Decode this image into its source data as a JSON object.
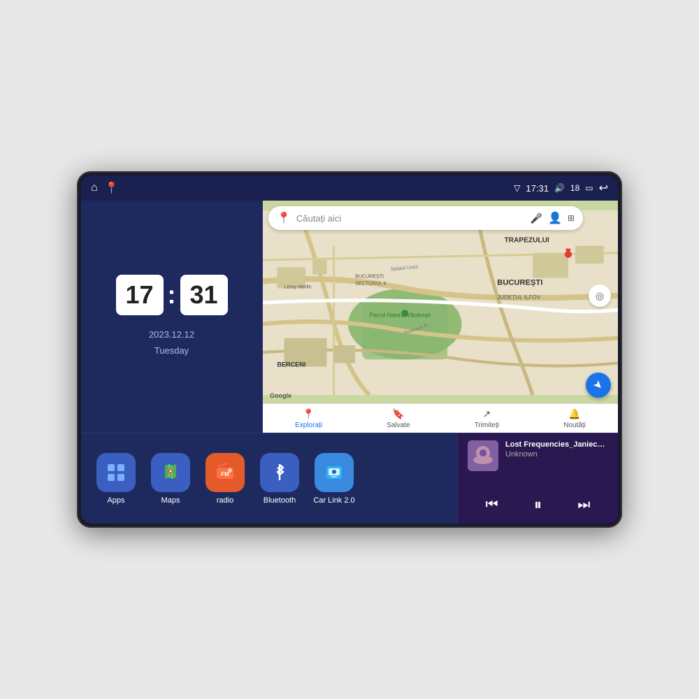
{
  "device": {
    "frame_bg": "#1a1a2e"
  },
  "status_bar": {
    "time": "17:31",
    "signal_icon": "▽",
    "volume_icon": "🔊",
    "battery_level": "18",
    "battery_icon": "🔋",
    "back_icon": "↩"
  },
  "clock": {
    "hours": "17",
    "minutes": "31",
    "date": "2023.12.12",
    "day": "Tuesday"
  },
  "map": {
    "search_placeholder": "Căutați aici",
    "trapezului_label": "TRAPEZULUI",
    "bucuresti_label": "BUCUREȘTI",
    "ilfov_label": "JUDEȚUL ILFOV",
    "berceni_label": "BERCENI",
    "parc_label": "Parcul Natural Văcărești",
    "leroy_label": "Leroy Merlin",
    "sector_label": "BUCUREȘTI SECTORUL 4",
    "google_label": "Google",
    "nav_items": [
      {
        "label": "Explorați",
        "active": true
      },
      {
        "label": "Salvate",
        "active": false
      },
      {
        "label": "Trimiteți",
        "active": false
      },
      {
        "label": "Noutăți",
        "active": false
      }
    ]
  },
  "apps": [
    {
      "label": "Apps",
      "icon_class": "icon-apps",
      "icon_char": "⊞"
    },
    {
      "label": "Maps",
      "icon_class": "icon-maps",
      "icon_char": "📍"
    },
    {
      "label": "radio",
      "icon_class": "icon-radio",
      "icon_char": "📻"
    },
    {
      "label": "Bluetooth",
      "icon_class": "icon-bluetooth",
      "icon_char": "⬥"
    },
    {
      "label": "Car Link 2.0",
      "icon_class": "icon-carlink",
      "icon_char": "📱"
    }
  ],
  "media": {
    "title": "Lost Frequencies_Janieck Devy-...",
    "artist": "Unknown",
    "prev_icon": "⏮",
    "play_icon": "⏸",
    "next_icon": "⏭"
  }
}
